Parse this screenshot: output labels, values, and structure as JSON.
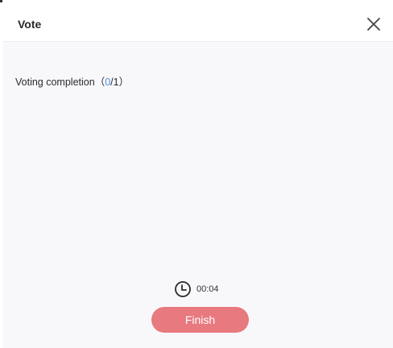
{
  "dialog": {
    "title": "Vote",
    "close_icon": "close-icon"
  },
  "completion": {
    "label": "Voting completion",
    "open_paren": "（",
    "voted": "0",
    "separator": "/1",
    "close_paren": "）"
  },
  "timer": {
    "icon": "clock-icon",
    "elapsed": "00:04"
  },
  "actions": {
    "finish_label": "Finish"
  },
  "colors": {
    "accent_button": "#e8797f",
    "voted_count": "#4a90e2",
    "dialog_background": "#f8f8fb"
  }
}
